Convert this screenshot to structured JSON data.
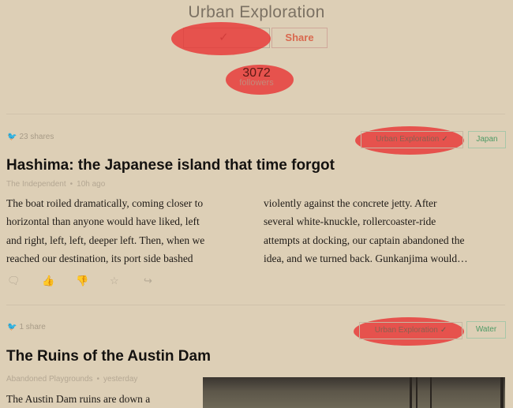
{
  "header": {
    "title": "Urban Exploration",
    "follow_check": "✓",
    "share_label": "Share",
    "followers_count": "3072",
    "followers_label": "followers"
  },
  "articles": [
    {
      "shares": "23 shares",
      "topic_tag": "Urban Exploration",
      "tag": "Japan",
      "title": "Hashima: the Japanese island that time forgot",
      "source": "The Independent",
      "time": "10h ago",
      "col1": [
        "The boat roiled dramatically, coming closer to",
        "horizontal than anyone would have liked, left",
        "and right, left, left, deeper left. Then, when we",
        "reached our destination, its port side bashed"
      ],
      "col2": [
        "violently against the concrete jetty. After",
        "several white-knuckle, rollercoaster-ride",
        "attempts at docking, our captain abandoned the",
        "idea, and we turned back. Gunkanjima would…"
      ]
    },
    {
      "shares": "1 share",
      "topic_tag": "Urban Exploration",
      "tag": "Water",
      "title": "The Ruins of the Austin Dam",
      "source": "Abandoned Playgrounds",
      "time": "yesterday",
      "col1": [
        "The Austin Dam ruins are down a"
      ]
    }
  ],
  "icons": {
    "twitter": "twitter-icon",
    "comment": "comment-icon",
    "like": "thumbs-up-icon",
    "dislike": "thumbs-down-icon",
    "save": "star-icon",
    "share": "share-icon"
  },
  "colors": {
    "background": "#ddcfb6",
    "highlight": "#e83636",
    "share_accent": "#d9694f",
    "tag_green": "#4e9a66"
  }
}
